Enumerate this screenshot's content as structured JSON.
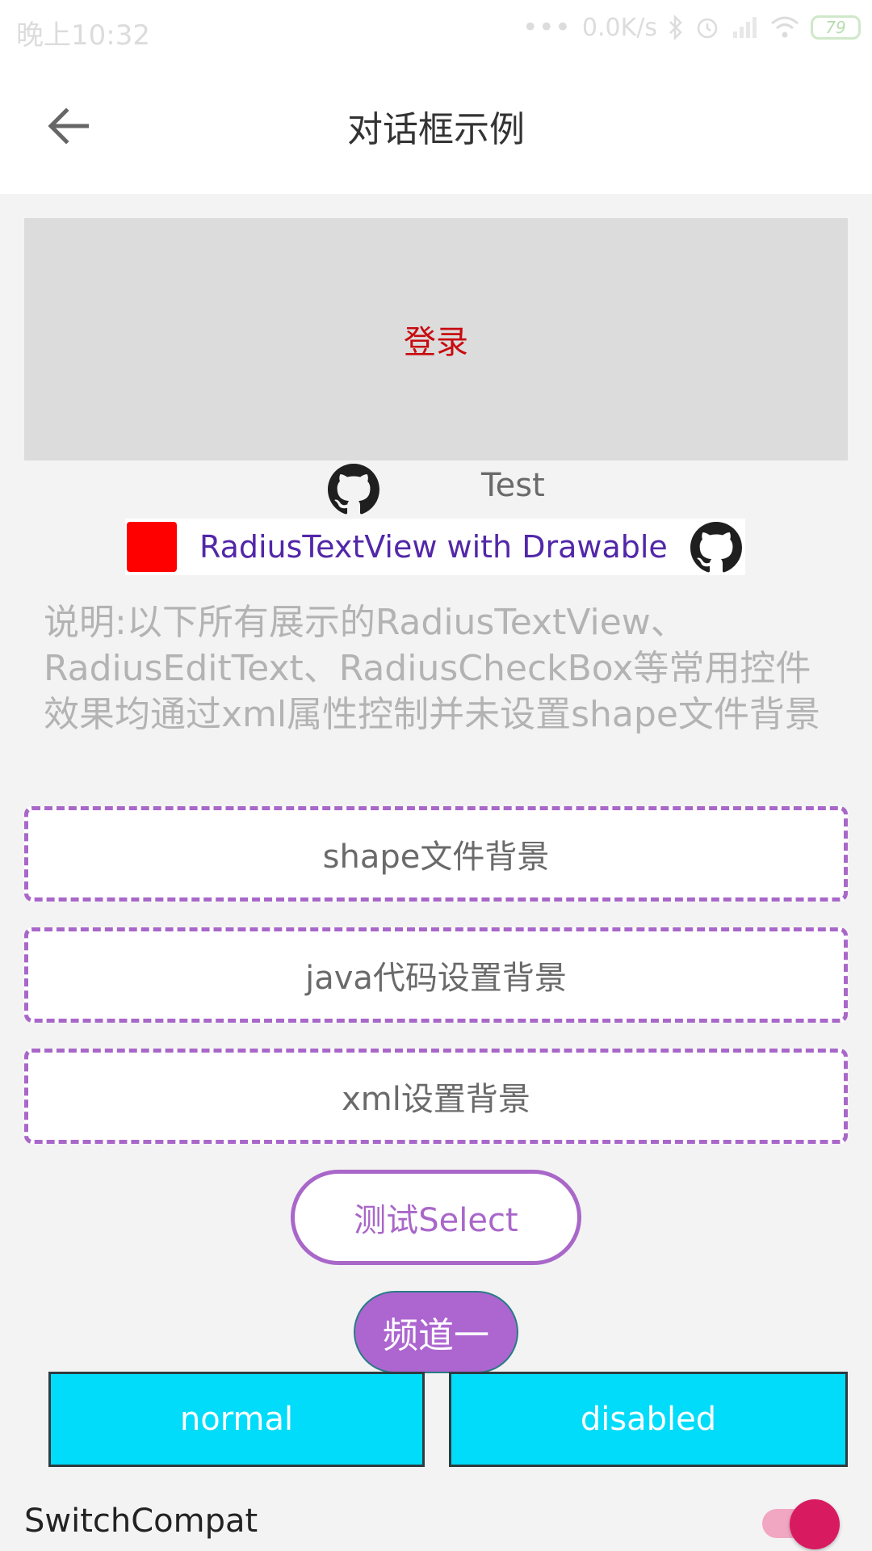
{
  "status_bar": {
    "time": "晚上10:32",
    "signal_dots": "•••",
    "net_speed": "0.0K/s",
    "battery": "79"
  },
  "toolbar": {
    "title": "对话框示例"
  },
  "login_block": {
    "label": "登录"
  },
  "test_row": {
    "label": "Test"
  },
  "drawable_row": {
    "label": "RadiusTextView with Drawable"
  },
  "description": {
    "text": "说明:以下所有展示的RadiusTextView、RadiusEditText、RadiusCheckBox等常用控件效果均通过xml属性控制并未设置shape文件背景"
  },
  "buttons": {
    "shape_bg": "shape文件背景",
    "java_bg": "java代码设置背景",
    "xml_bg": "xml设置背景",
    "select_test": "测试Select",
    "channel_one": "频道一",
    "normal": "normal",
    "disabled": "disabled"
  },
  "switch": {
    "label": "SwitchCompat",
    "checked": true
  },
  "colors": {
    "dashed_border": "#a967c9",
    "login_text": "#c70b10",
    "drawable_text": "#5227a8",
    "cyan_button": "#00dcfa",
    "switch_thumb": "#d81b60"
  }
}
